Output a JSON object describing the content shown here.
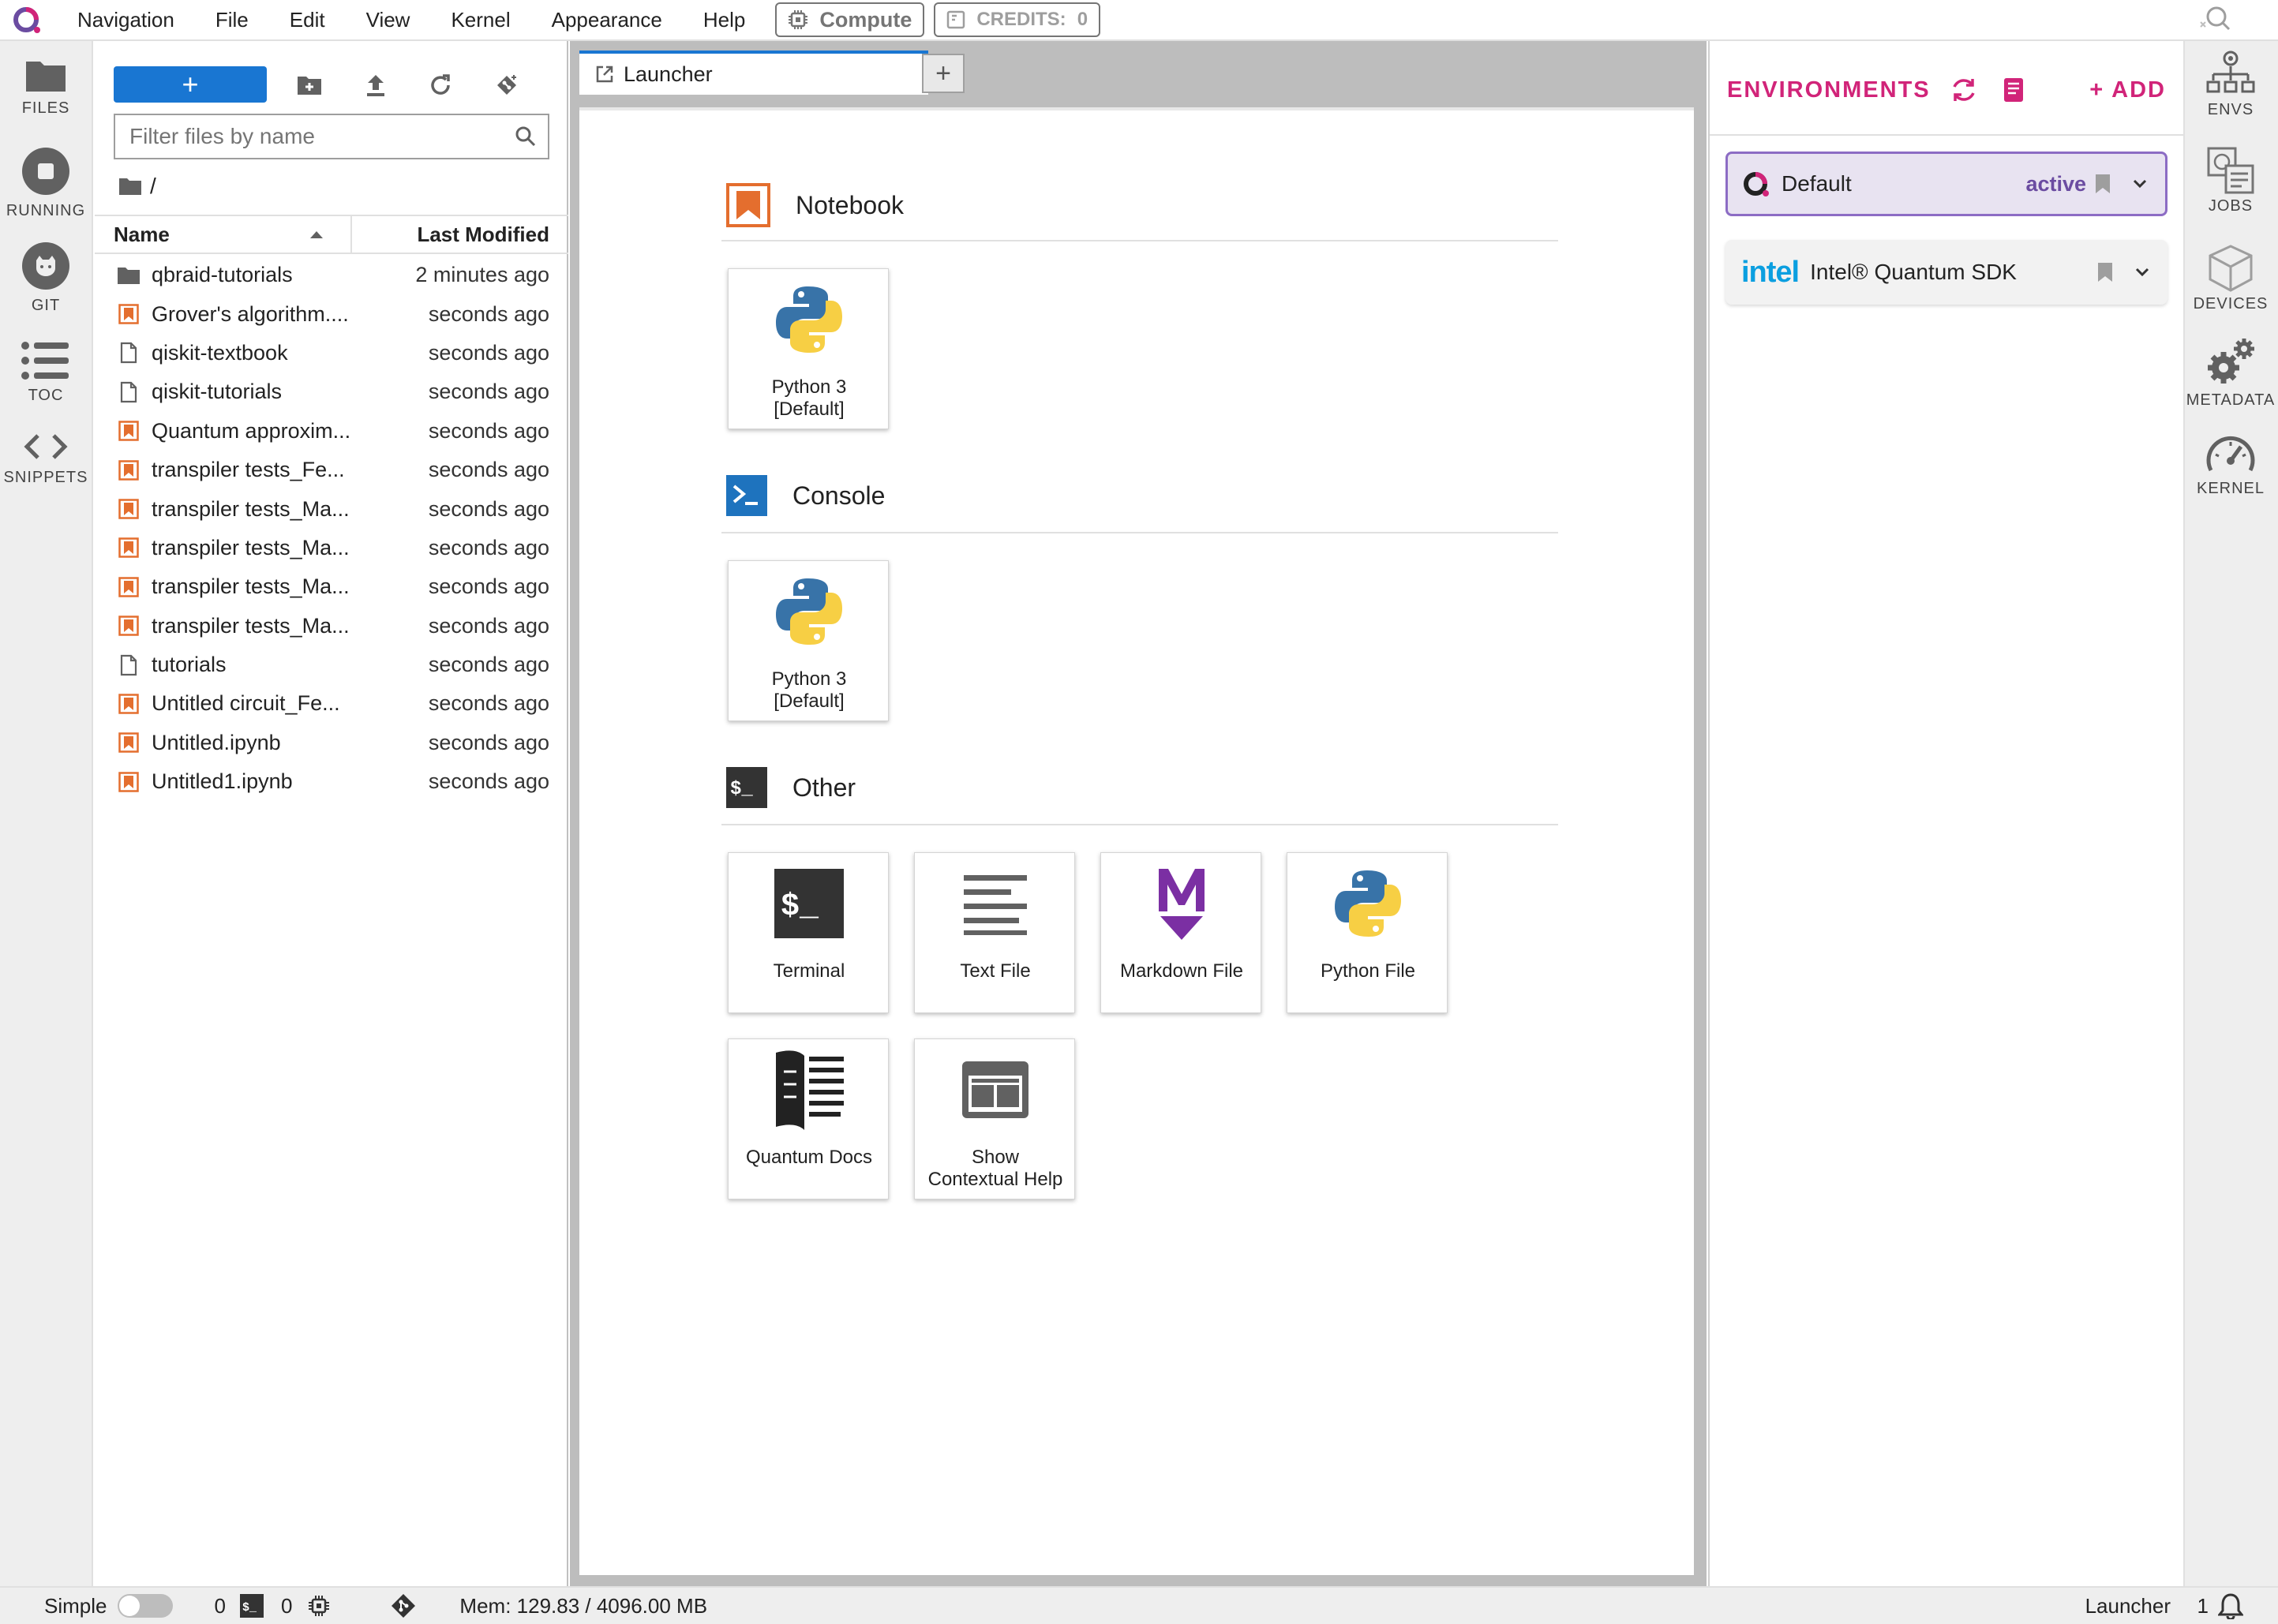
{
  "menubar": {
    "items": [
      "Navigation",
      "File",
      "Edit",
      "View",
      "Kernel",
      "Appearance",
      "Help"
    ],
    "compute_label": "Compute",
    "credits_label": "CREDITS:",
    "credits_value": "0"
  },
  "left_sidebar": {
    "tabs": [
      {
        "label": "FILES",
        "icon": "folder-icon"
      },
      {
        "label": "RUNNING",
        "icon": "stop-circle-icon"
      },
      {
        "label": "GIT",
        "icon": "git-icon"
      },
      {
        "label": "TOC",
        "icon": "list-icon"
      },
      {
        "label": "SNIPPETS",
        "icon": "code-icon"
      }
    ]
  },
  "file_browser": {
    "new_button_label": "+",
    "filter_placeholder": "Filter files by name",
    "breadcrumb": "/",
    "columns": {
      "name": "Name",
      "modified": "Last Modified"
    },
    "files": [
      {
        "name": "qbraid-tutorials",
        "modified": "2 minutes ago",
        "type": "folder"
      },
      {
        "name": "Grover's algorithm....",
        "modified": "seconds ago",
        "type": "notebook"
      },
      {
        "name": "qiskit-textbook",
        "modified": "seconds ago",
        "type": "file"
      },
      {
        "name": "qiskit-tutorials",
        "modified": "seconds ago",
        "type": "file"
      },
      {
        "name": "Quantum approxim...",
        "modified": "seconds ago",
        "type": "notebook"
      },
      {
        "name": "transpiler tests_Fe...",
        "modified": "seconds ago",
        "type": "notebook"
      },
      {
        "name": "transpiler tests_Ma...",
        "modified": "seconds ago",
        "type": "notebook"
      },
      {
        "name": "transpiler tests_Ma...",
        "modified": "seconds ago",
        "type": "notebook"
      },
      {
        "name": "transpiler tests_Ma...",
        "modified": "seconds ago",
        "type": "notebook"
      },
      {
        "name": "transpiler tests_Ma...",
        "modified": "seconds ago",
        "type": "notebook"
      },
      {
        "name": "tutorials",
        "modified": "seconds ago",
        "type": "file"
      },
      {
        "name": "Untitled circuit_Fe...",
        "modified": "seconds ago",
        "type": "notebook"
      },
      {
        "name": "Untitled.ipynb",
        "modified": "seconds ago",
        "type": "notebook"
      },
      {
        "name": "Untitled1.ipynb",
        "modified": "seconds ago",
        "type": "notebook"
      }
    ]
  },
  "main": {
    "tab_label": "Launcher",
    "add_tab_label": "+",
    "sections": {
      "notebook": {
        "title": "Notebook",
        "cards": [
          {
            "line1": "Python 3",
            "line2": "[Default]"
          }
        ]
      },
      "console": {
        "title": "Console",
        "cards": [
          {
            "line1": "Python 3",
            "line2": "[Default]"
          }
        ]
      },
      "other": {
        "title": "Other",
        "cards": [
          {
            "line1": "Terminal",
            "line2": ""
          },
          {
            "line1": "Text File",
            "line2": ""
          },
          {
            "line1": "Markdown File",
            "line2": ""
          },
          {
            "line1": "Python File",
            "line2": ""
          },
          {
            "line1": "Quantum Docs",
            "line2": ""
          },
          {
            "line1": "Show",
            "line2": "Contextual Help"
          }
        ]
      }
    }
  },
  "env_panel": {
    "title": "ENVIRONMENTS",
    "add_label": "+ ADD",
    "environments": [
      {
        "name": "Default",
        "status": "active"
      },
      {
        "name": "Intel® Quantum SDK",
        "status": "",
        "logo_text": "intel"
      }
    ]
  },
  "right_sidebar": {
    "tabs": [
      {
        "label": "ENVS",
        "icon": "envs-icon"
      },
      {
        "label": "JOBS",
        "icon": "jobs-icon"
      },
      {
        "label": "DEVICES",
        "icon": "devices-icon"
      },
      {
        "label": "METADATA",
        "icon": "gears-icon"
      },
      {
        "label": "KERNEL",
        "icon": "gauge-icon"
      }
    ]
  },
  "statusbar": {
    "mode_label": "Simple",
    "terminals_count": "0",
    "kernels_count": "0",
    "memory": "Mem: 129.83 / 4096.00 MB",
    "active_doc": "Launcher",
    "notifications_count": "1"
  },
  "colors": {
    "accent_blue": "#1976d2",
    "brand_pink": "#d12479",
    "active_purple": "#6b4ca1",
    "notebook_orange": "#e46e2e"
  }
}
